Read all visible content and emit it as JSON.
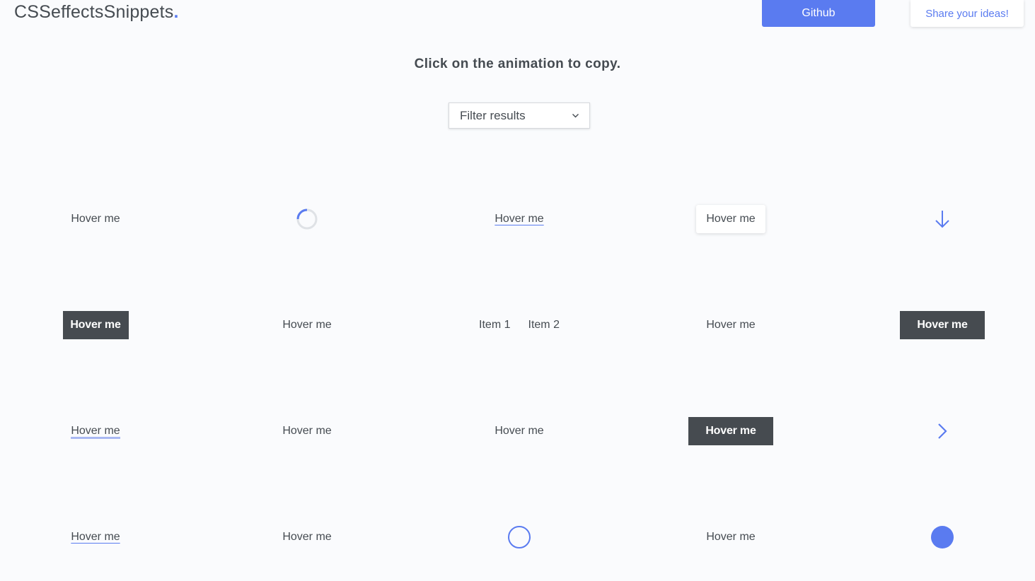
{
  "header": {
    "logo_text": "CSSeffectsSnippets",
    "logo_dot": ".",
    "github_label": "Github",
    "share_label": "Share your ideas!"
  },
  "subtitle": "Click on the animation to copy.",
  "filter": {
    "label": "Filter results"
  },
  "snippets": {
    "r1c1": "Hover me",
    "r1c3": "Hover me",
    "r1c4": "Hover me",
    "r2c1": "Hover me",
    "r2c2": "Hover me",
    "r2c3_item1": "Item 1",
    "r2c3_item2": "Item 2",
    "r2c4": "Hover me",
    "r2c5": "Hover me",
    "r3c1": "Hover me",
    "r3c2": "Hover me",
    "r3c3": "Hover me",
    "r3c4": "Hover me",
    "r4c1": "Hover me",
    "r4c2": "Hover me",
    "r4c4": "Hover me"
  },
  "colors": {
    "accent": "#5a7bf0",
    "dark": "#464b50",
    "background": "#fafbfd"
  },
  "icons": {
    "spinner": "spinner-icon",
    "arrow_down": "arrow-down-icon",
    "chevron_right": "chevron-right-icon",
    "circle_outline": "circle-outline-icon",
    "circle_filled": "circle-filled-icon",
    "filter_chevron": "chevron-down-icon"
  }
}
